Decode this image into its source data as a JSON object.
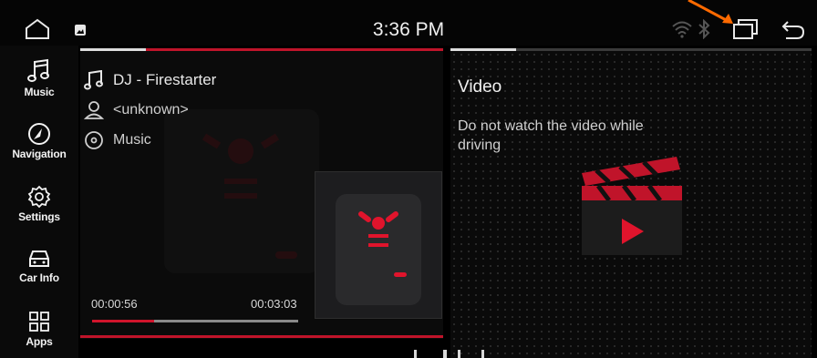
{
  "status_bar": {
    "time": "3:36 PM",
    "icons": [
      "home-icon",
      "notification-icon",
      "wifi-icon",
      "bluetooth-icon",
      "recents-icon",
      "back-icon"
    ]
  },
  "sidebar": {
    "items": [
      {
        "label": "Music",
        "icon": "music-note-icon"
      },
      {
        "label": "Navigation",
        "icon": "navigation-icon"
      },
      {
        "label": "Settings",
        "icon": "gear-icon"
      },
      {
        "label": "Car Info",
        "icon": "car-icon"
      },
      {
        "label": "Apps",
        "icon": "apps-grid-icon"
      }
    ]
  },
  "music": {
    "title": "DJ - Firestarter",
    "artist": "<unknown>",
    "album": "Music",
    "elapsed": "00:00:56",
    "duration": "00:03:03",
    "progress_fraction": 0.3
  },
  "video": {
    "title": "Video",
    "warning": "Do not watch the video while driving"
  },
  "colors": {
    "accent": "#d0142c",
    "background": "#000000",
    "annotation": "#ff6a00"
  }
}
